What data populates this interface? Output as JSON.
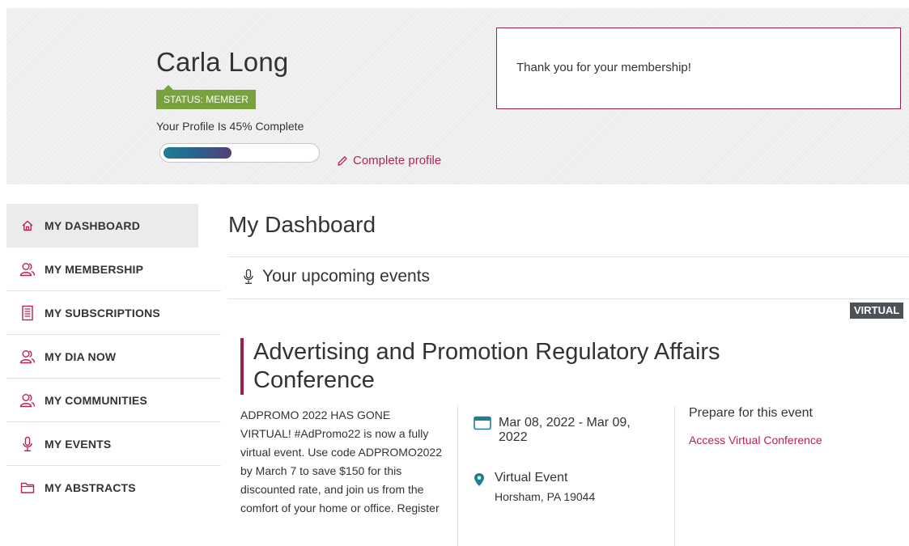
{
  "profile": {
    "name": "Carla Long",
    "status_badge": "STATUS: MEMBER",
    "completion_text": "Your Profile Is 45% Complete",
    "completion_value": 0.45,
    "complete_link": "Complete profile",
    "thank_you": "Thank you for your membership!"
  },
  "sidebar": {
    "items": [
      {
        "label": "MY DASHBOARD",
        "icon": "home-icon",
        "active": true
      },
      {
        "label": "MY MEMBERSHIP",
        "icon": "users-icon",
        "active": false
      },
      {
        "label": "MY SUBSCRIPTIONS",
        "icon": "document-icon",
        "active": false
      },
      {
        "label": "MY DIA NOW",
        "icon": "users-icon",
        "active": false
      },
      {
        "label": "MY COMMUNITIES",
        "icon": "users-icon",
        "active": false
      },
      {
        "label": "MY EVENTS",
        "icon": "microphone-icon",
        "active": false
      },
      {
        "label": "MY ABSTRACTS",
        "icon": "folder-icon",
        "active": false
      }
    ]
  },
  "main": {
    "title": "My Dashboard",
    "upcoming_header": "Your upcoming events",
    "event": {
      "badge": "VIRTUAL",
      "title": "Advertising and Promotion Regulatory Affairs Conference",
      "description": "ADPROMO 2022 HAS GONE VIRTUAL! #AdPromo22 is now a fully virtual event. Use code ADPROMO2022 by March 7 to save $150 for this discounted rate, and join us from the comfort of your home or office. Register",
      "dates": "Mar 08, 2022 - Mar 09, 2022",
      "location_title": "Virtual Event",
      "location_address": "Horsham, PA 19044",
      "prepare_heading": "Prepare for this event",
      "access_link": "Access Virtual Conference"
    }
  },
  "colors": {
    "accent": "#b62358",
    "status_green": "#77a23e",
    "border_maroon": "#9b1f4f",
    "virtual_badge": "#4d5258",
    "progress_start": "#1e7e93",
    "progress_end": "#533f78"
  }
}
